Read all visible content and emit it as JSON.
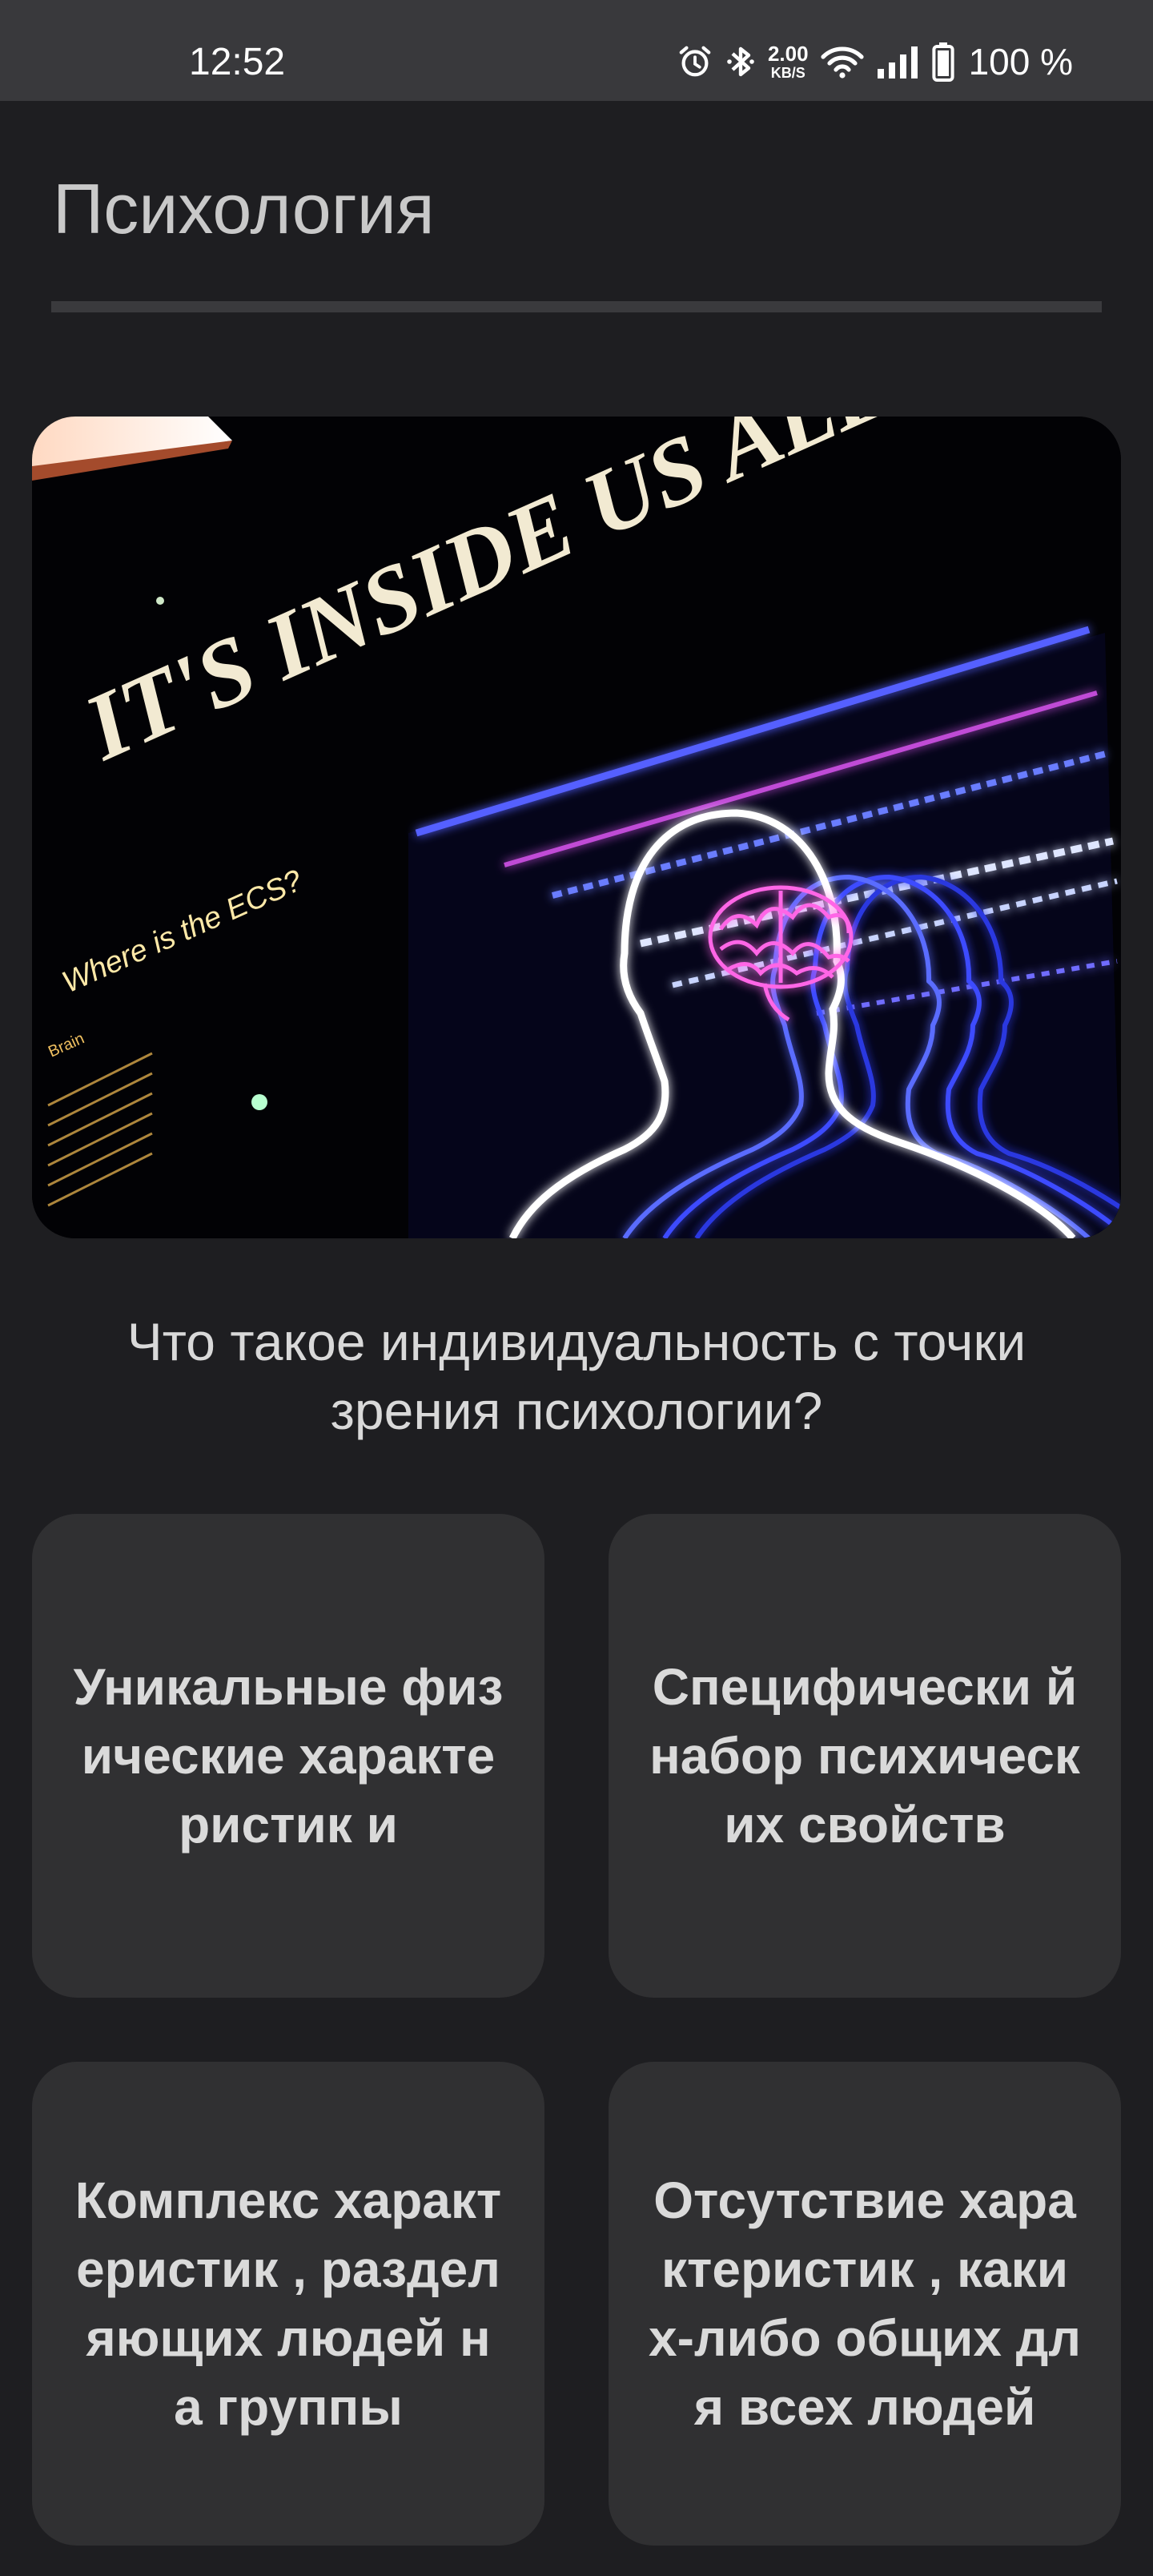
{
  "status_bar": {
    "time": "12:52",
    "net_speed_value": "2.00",
    "net_speed_unit": "KB/S",
    "battery": "100 %",
    "icons": [
      "alarm-icon",
      "bluetooth-icon",
      "wifi-icon",
      "signal-icon",
      "battery-icon"
    ]
  },
  "header": {
    "title": "Психология"
  },
  "image": {
    "icon": "exhibit-photo",
    "headline": "IT'S INSIDE US ALL",
    "caption": "Where is the ECS?",
    "panel_title": "Brain"
  },
  "question": {
    "text": "Что такое индивидуальность с точки зрения психологии?"
  },
  "answers": [
    {
      "label": "Уникальные физические характеристик и"
    },
    {
      "label": "Специфически й набор психических свойств"
    },
    {
      "label": "Комплекс характеристик , разделяющих людей на группы"
    },
    {
      "label": "Отсутствие характеристик , каких-либо общих для всех людей"
    }
  ],
  "colors": {
    "background": "#1e1e21",
    "status_bar": "#39393c",
    "card": "#303032",
    "text": "#dadada"
  }
}
